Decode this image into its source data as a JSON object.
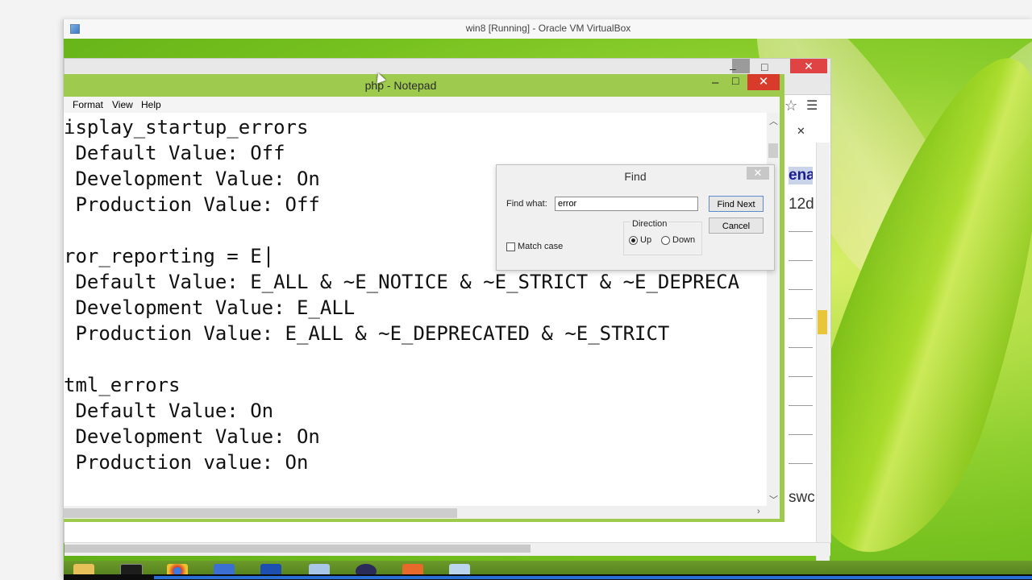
{
  "vbox": {
    "title": "win8 [Running] - Oracle VM VirtualBox"
  },
  "notepad": {
    "title": "php - Notepad",
    "menu": [
      "Format",
      "View",
      "Help"
    ],
    "lines": [
      "isplay_startup_errors",
      " Default Value: Off",
      " Development Value: On",
      " Production Value: Off",
      "",
      "ror_reporting = E",
      " Default Value: E_ALL & ~E_NOTICE & ~E_STRICT & ~E_DEPRECA",
      " Development Value: E_ALL",
      " Production Value: E_ALL & ~E_DEPRECATED & ~E_STRICT",
      "",
      "tml_errors",
      " Default Value: On",
      " Development Value: On",
      " Production value: On"
    ]
  },
  "find": {
    "title": "Find",
    "find_what_label": "Find what:",
    "find_what_value": "error",
    "find_next_label": "Find Next",
    "cancel_label": "Cancel",
    "direction_label": "Direction",
    "up_label": "Up",
    "down_label": "Down",
    "match_case_label": "Match case",
    "direction_selected": "Up",
    "match_case_checked": false
  },
  "browser": {
    "side_text_1": "ena",
    "side_text_2": "12d",
    "side_text_3": "swc"
  },
  "icons": {
    "minimize": "minimize-icon",
    "maximize": "maximize-icon",
    "close": "close-icon",
    "star": "star-icon",
    "menu": "hamburger-menu-icon"
  },
  "colors": {
    "notepad_frame": "#9ecb4d",
    "close_red": "#d93b2b",
    "progress_blue": "#2a6fd6"
  }
}
